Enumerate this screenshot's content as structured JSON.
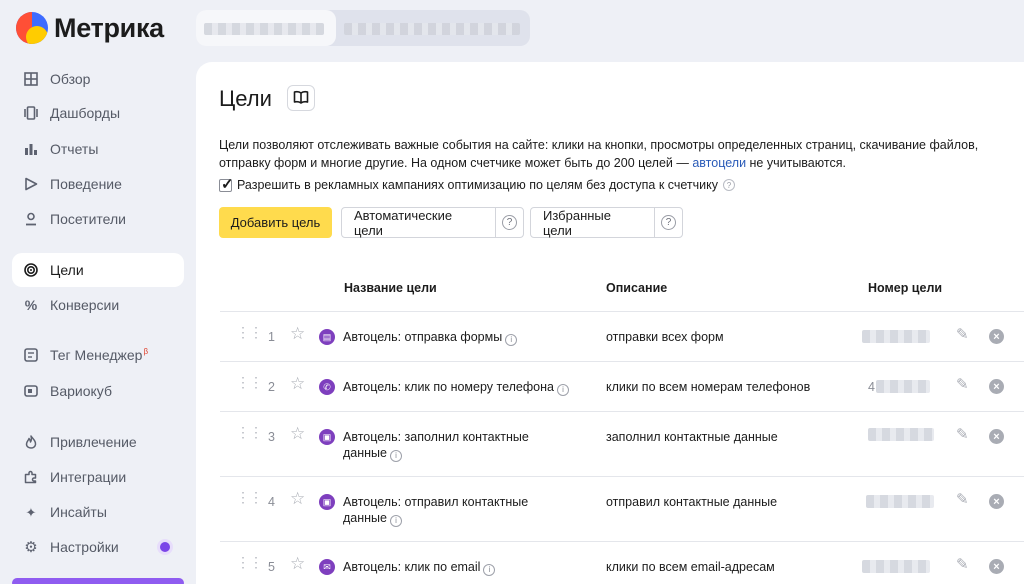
{
  "app": {
    "logo_text": "Метрика"
  },
  "sidebar": {
    "items": [
      {
        "label": "Обзор",
        "icon": "grid-icon"
      },
      {
        "label": "Дашборды",
        "icon": "dashboard-icon"
      },
      {
        "label": "Отчеты",
        "icon": "bar-chart-icon"
      },
      {
        "label": "Поведение",
        "icon": "play-icon"
      },
      {
        "label": "Посетители",
        "icon": "user-icon"
      },
      {
        "label": "Цели",
        "icon": "target-icon",
        "active": true
      },
      {
        "label": "Конверсии",
        "icon": "percent-icon"
      },
      {
        "label": "Тег Менеджер",
        "icon": "tag-manager-icon",
        "badge": "β"
      },
      {
        "label": "Вариокуб",
        "icon": "variocube-icon"
      },
      {
        "label": "Привлечение",
        "icon": "flame-icon"
      },
      {
        "label": "Интеграции",
        "icon": "puzzle-icon"
      },
      {
        "label": "Инсайты",
        "icon": "sparkle-icon"
      },
      {
        "label": "Настройки",
        "icon": "gear-icon"
      }
    ]
  },
  "page": {
    "title": "Цели",
    "description_part1": "Цели позволяют отслеживать важные события на сайте: клики на кнопки, просмотры определенных страниц, скачивание файлов, отправку форм и многие другие. На одном счетчике может быть до 200 целей — ",
    "description_link": "автоцели",
    "description_part2": " не учитываются.",
    "checkbox_label": "Разрешить в рекламных кампаниях оптимизацию по целям без доступа к счетчику",
    "checkbox_checked": true
  },
  "toolbar": {
    "add_label": "Добавить цель",
    "auto_label": "Автоматические цели",
    "fav_label": "Избранные цели"
  },
  "table": {
    "headers": {
      "name": "Название цели",
      "description": "Описание",
      "number": "Номер цели"
    },
    "rows": [
      {
        "index": "1",
        "name_line1": "Автоцель: отправка формы",
        "name_line2": "",
        "description": "отправки всех форм",
        "icon": "form-icon"
      },
      {
        "index": "2",
        "name_line1": "Автоцель: клик по номеру телефона",
        "name_line2": "",
        "description": "клики по всем номерам телефонов",
        "icon": "phone-icon",
        "number_prefix": "4"
      },
      {
        "index": "3",
        "name_line1": "Автоцель: заполнил контактные",
        "name_line2": "данные",
        "description": "заполнил контактные данные",
        "icon": "contact-card-icon"
      },
      {
        "index": "4",
        "name_line1": "Автоцель: отправил контактные",
        "name_line2": "данные",
        "description": "отправил контактные данные",
        "icon": "contact-card-icon"
      },
      {
        "index": "5",
        "name_line1": "Автоцель: клик по email",
        "name_line2": "",
        "description": "клики по всем email-адресам",
        "icon": "email-icon"
      }
    ]
  }
}
